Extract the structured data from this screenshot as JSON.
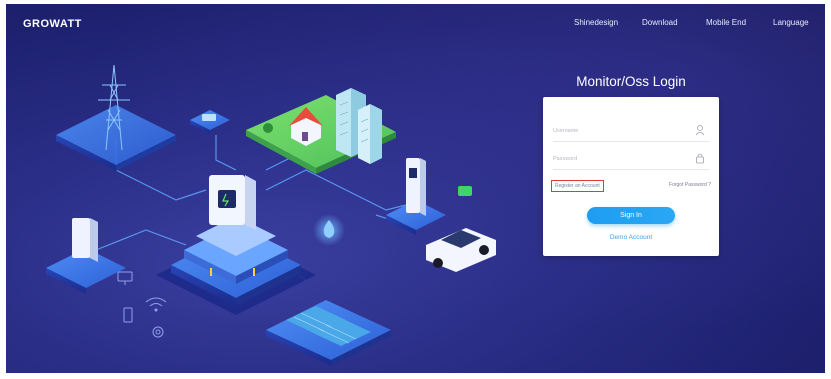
{
  "brand": {
    "logo_text": "GROWATT"
  },
  "nav": {
    "items": [
      {
        "label": "Shinedesign"
      },
      {
        "label": "Download"
      },
      {
        "label": "Mobile End"
      },
      {
        "label": "Language"
      }
    ]
  },
  "login": {
    "title": "Monitor/Oss Login",
    "username_placeholder": "Username",
    "password_placeholder": "Password",
    "register_label": "Register an Account",
    "forgot_label": "Forgot Password ?",
    "signin_label": "Sign In",
    "demo_label": "Demo Account"
  },
  "colors": {
    "background": "#22266f",
    "accent": "#1e9cf0",
    "highlight_box": "#e03a3a",
    "isometric_green": "#6fd66a",
    "isometric_blue": "#4a8df0"
  },
  "scene": {
    "icons": [
      "power-tower-icon",
      "house-icon",
      "building-icon",
      "ev-charger-icon",
      "car-icon",
      "inverter-icon",
      "battery-icon",
      "solar-panel-icon",
      "router-icon",
      "cloud-icon",
      "monitor-icon",
      "phone-icon",
      "wifi-icon",
      "gear-icon"
    ]
  }
}
